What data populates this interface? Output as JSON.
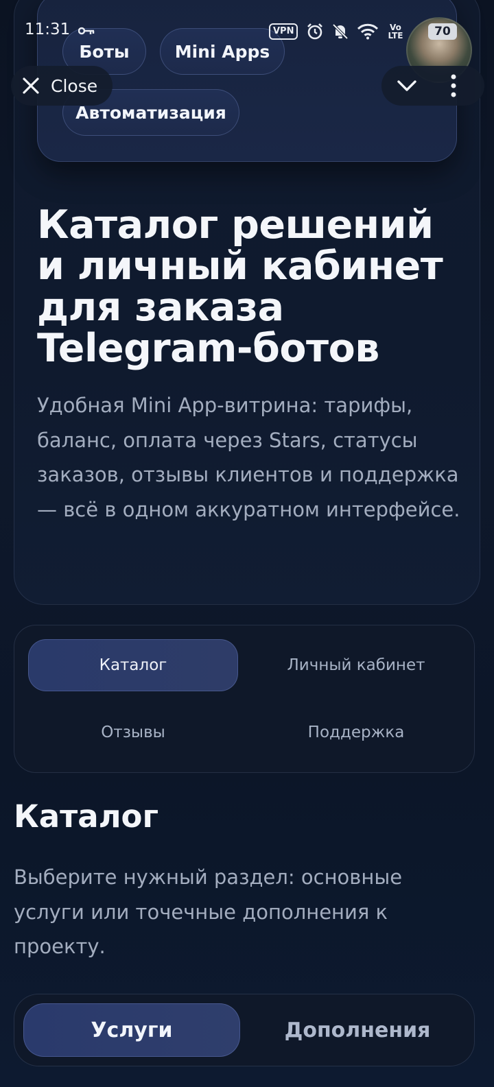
{
  "status_bar": {
    "time": "11:31",
    "vpn_label": "VPN",
    "network_label": "Vo LTE",
    "battery": "70"
  },
  "topbar": {
    "close_label": "Close"
  },
  "hero": {
    "tags": [
      "Боты",
      "Mini Apps",
      "Автоматизация"
    ],
    "title": "Каталог решений и личный кабинет для заказа Telegram-ботов",
    "description": "Удобная Mini App-витрина: тарифы, баланс, оплата через Stars, статусы заказов, отзывы клиентов и поддержка — всё в одном аккуратном интерфейсе."
  },
  "nav_tabs": [
    {
      "label": "Каталог",
      "active": true
    },
    {
      "label": "Личный кабинет",
      "active": false
    },
    {
      "label": "Отзывы",
      "active": false
    },
    {
      "label": "Поддержка",
      "active": false
    }
  ],
  "catalog": {
    "title": "Каталог",
    "description": "Выберите нужный раздел: основные услуги или точечные дополнения к проекту."
  },
  "segments": [
    {
      "label": "Услуги",
      "active": true
    },
    {
      "label": "Дополнения",
      "active": false
    }
  ],
  "colors": {
    "background": "#0e182b",
    "accent": "#2a3a6a",
    "text_primary": "#f4f6fa",
    "text_secondary": "#a3adbf"
  }
}
